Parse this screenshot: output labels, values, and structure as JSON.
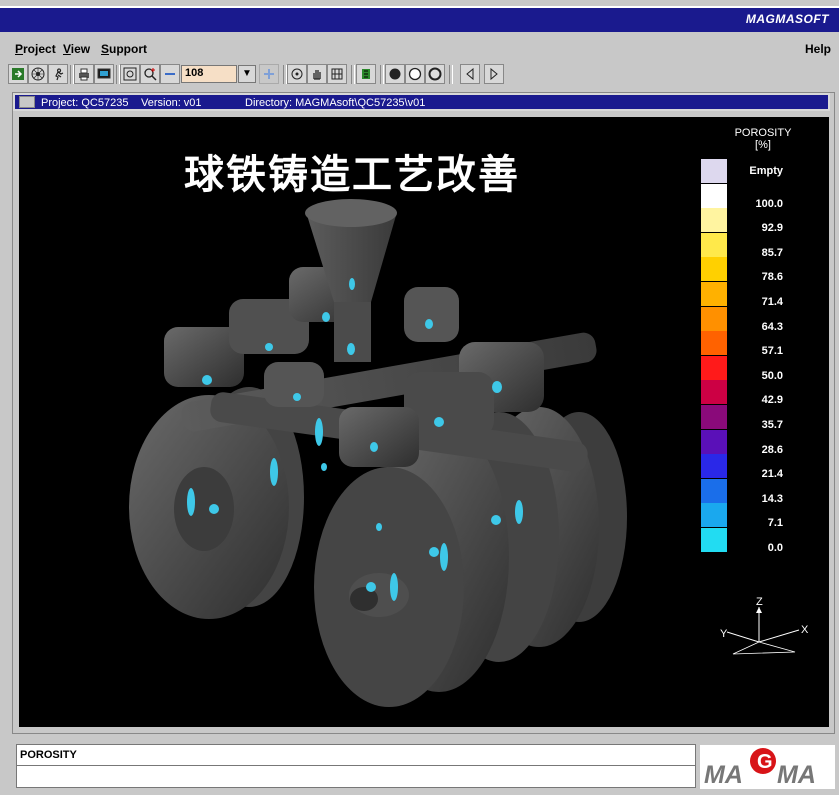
{
  "app": {
    "title": "MAGMASOFT"
  },
  "menu": {
    "project": "Project",
    "view": "View",
    "support": "Support",
    "help": "Help"
  },
  "toolbar": {
    "zoom_value": "108"
  },
  "window": {
    "project": "Project: QC57235",
    "version": "Version: v01",
    "directory": "Directory: MAGMAsoft\\QC57235\\v01"
  },
  "viewport": {
    "banner": "球铁铸造工艺改善"
  },
  "legend": {
    "title_line1": "POROSITY",
    "title_line2": "[%]",
    "entries": [
      {
        "label": "Empty",
        "color": "#ddd8ee"
      },
      {
        "label": "100.0",
        "color": "#ffffff"
      },
      {
        "label": "92.9",
        "color": "#fff4a0"
      },
      {
        "label": "85.7",
        "color": "#ffe94a"
      },
      {
        "label": "78.6",
        "color": "#ffd000"
      },
      {
        "label": "71.4",
        "color": "#ffb100"
      },
      {
        "label": "64.3",
        "color": "#ff9000"
      },
      {
        "label": "57.1",
        "color": "#ff6200"
      },
      {
        "label": "50.0",
        "color": "#ff1a1a"
      },
      {
        "label": "42.9",
        "color": "#cc0044"
      },
      {
        "label": "35.7",
        "color": "#8a0a7a"
      },
      {
        "label": "28.6",
        "color": "#5a10b8"
      },
      {
        "label": "21.4",
        "color": "#2a28e8"
      },
      {
        "label": "14.3",
        "color": "#1a6eea"
      },
      {
        "label": "7.1",
        "color": "#1aa8ee"
      },
      {
        "label": "0.0",
        "color": "#22dcf2"
      }
    ]
  },
  "axes": {
    "z": "Z",
    "y": "Y",
    "x": "X"
  },
  "status": {
    "label": "POROSITY"
  },
  "logo": {
    "text": "MAGMA"
  },
  "colors": {
    "titlebar": "#1a1a8e",
    "model": "#4a4a4a",
    "porosity": "#3ec8e8"
  }
}
